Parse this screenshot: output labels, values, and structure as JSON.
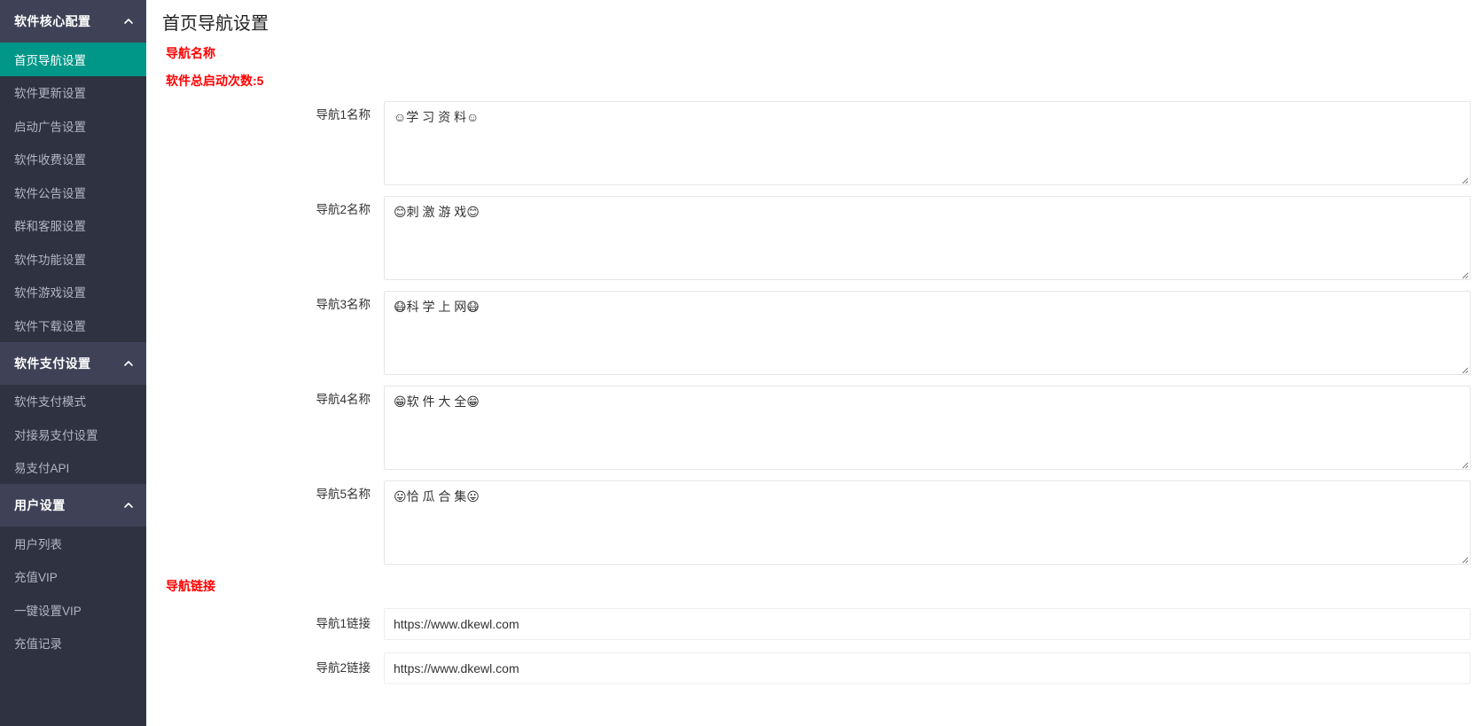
{
  "sidebar": {
    "groups": [
      {
        "label": "软件核心配置",
        "icon": "chevron-up-icon",
        "items": [
          {
            "label": "首页导航设置",
            "active": true
          },
          {
            "label": "软件更新设置",
            "active": false
          },
          {
            "label": "启动广告设置",
            "active": false
          },
          {
            "label": "软件收费设置",
            "active": false
          },
          {
            "label": "软件公告设置",
            "active": false
          },
          {
            "label": "群和客服设置",
            "active": false
          },
          {
            "label": "软件功能设置",
            "active": false
          },
          {
            "label": "软件游戏设置",
            "active": false
          },
          {
            "label": "软件下载设置",
            "active": false
          }
        ]
      },
      {
        "label": "软件支付设置",
        "icon": "chevron-up-icon",
        "items": [
          {
            "label": "软件支付模式",
            "active": false
          },
          {
            "label": "对接易支付设置",
            "active": false
          },
          {
            "label": "易支付API",
            "active": false
          }
        ]
      },
      {
        "label": "用户设置",
        "icon": "chevron-up-icon",
        "items": [
          {
            "label": "用户列表",
            "active": false
          },
          {
            "label": "充值VIP",
            "active": false
          },
          {
            "label": "一键设置VIP",
            "active": false
          },
          {
            "label": "充值记录",
            "active": false
          }
        ]
      }
    ]
  },
  "main": {
    "title": "首页导航设置",
    "name_section": {
      "heading": "导航名称",
      "launch_count_label": "软件总启动次数:5",
      "fields": [
        {
          "label": "导航1名称",
          "value": "☺学 习 资 料☺"
        },
        {
          "label": "导航2名称",
          "value": "😊刺 激 游 戏😊"
        },
        {
          "label": "导航3名称",
          "value": "😷科 学 上 网😷"
        },
        {
          "label": "导航4名称",
          "value": "😁软 件 大 全😁"
        },
        {
          "label": "导航5名称",
          "value": "😛恰 瓜 合 集😛"
        }
      ]
    },
    "link_section": {
      "heading": "导航链接",
      "fields": [
        {
          "label": "导航1链接",
          "value": "https://www.dkewl.com"
        },
        {
          "label": "导航2链接",
          "value": "https://www.dkewl.com"
        }
      ]
    }
  },
  "colors": {
    "sidebar_bg": "#2f3241",
    "sidebar_group_bg": "#3f4257",
    "accent": "#009688",
    "section_heading": "#ff0000"
  }
}
